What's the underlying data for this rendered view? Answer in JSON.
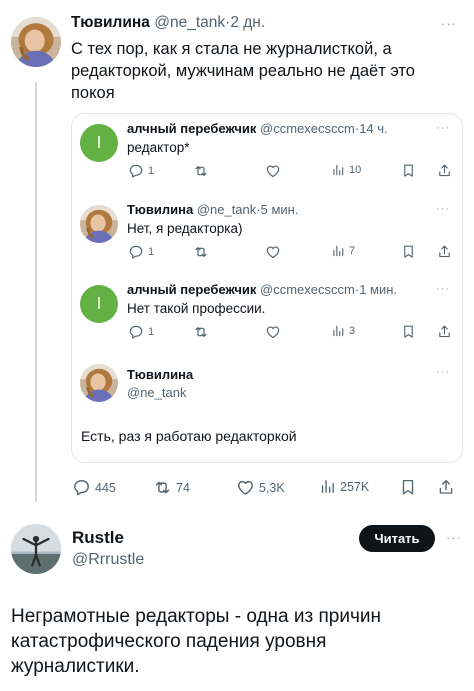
{
  "main_post": {
    "author_name": "Тювилина",
    "author_handle": "@ne_tank",
    "time": "2 дн.",
    "text_line1": "С тех пор, как я стала не журналисткой, а",
    "text_line2": "редакторкой, мужчинам реально не даёт это",
    "text_line3": "покоя",
    "actions": {
      "replies": "445",
      "reposts": "74",
      "likes": "5,3K",
      "views": "257K"
    }
  },
  "quote": {
    "tweets": [
      {
        "author_name": "алчный перебежчик",
        "author_handle": "@ccmexecscсm",
        "time": "14 ч.",
        "text": "редактор*",
        "avatar_letter": "l",
        "replies": "1",
        "views": "10"
      },
      {
        "author_name": "Тювилина",
        "author_handle": "@ne_tank",
        "time": "5 мин.",
        "text": "Нет, я редакторка)",
        "replies": "1",
        "views": "7"
      },
      {
        "author_name": "алчный перебежчик",
        "author_handle": "@ccmexecscсm",
        "time": "1 мин.",
        "text": "Нет такой профессии.",
        "avatar_letter": "l",
        "replies": "1",
        "views": "3"
      }
    ],
    "expanded": {
      "author_name": "Тювилина",
      "author_handle": "@ne_tank",
      "text": "Есть, раз я работаю редакторкой"
    }
  },
  "reply": {
    "author_name": "Rustle",
    "author_handle": "@Rrrustle",
    "follow_label": "Читать",
    "text_line1": "Неграмотные редакторы - одна из причин",
    "text_line2": "катастрофического падения уровня",
    "text_line3": "журналистики."
  },
  "colors": {
    "accent_green": "#63b043",
    "follow_bg": "#0f1419",
    "muted": "#536471"
  },
  "dots_glyph": "···",
  "sep": "·"
}
